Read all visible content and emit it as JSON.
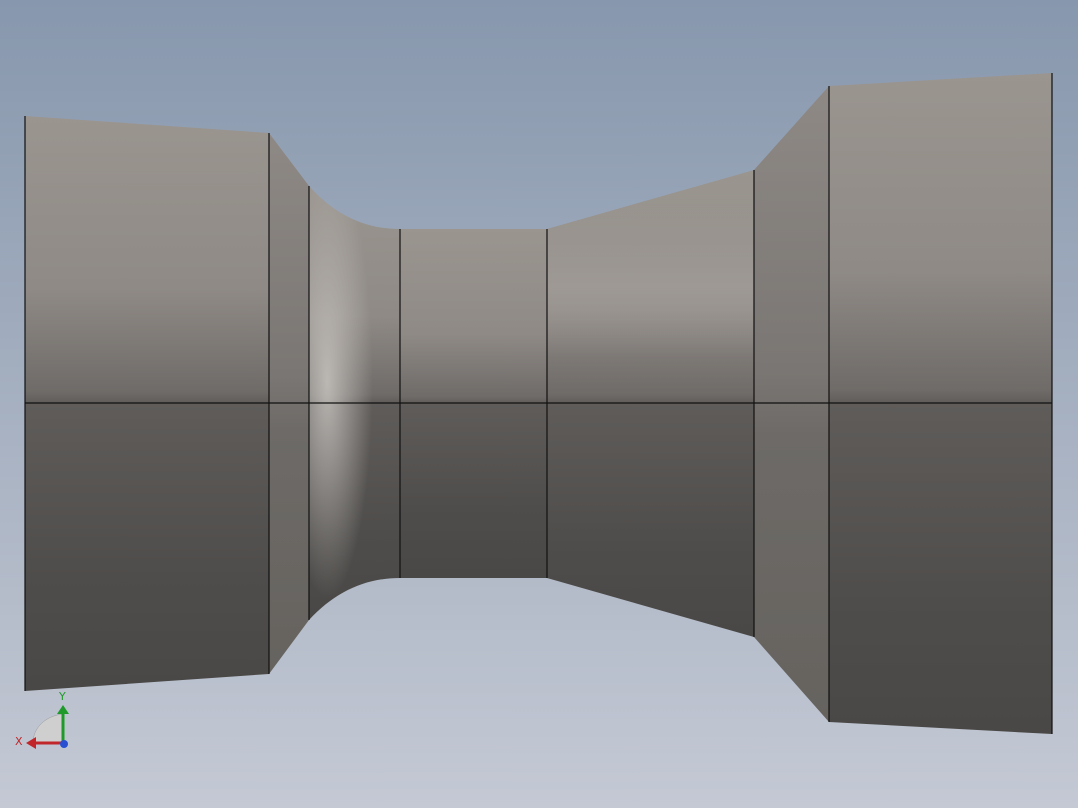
{
  "viewport": {
    "background_top": "#8797ad",
    "background_bottom": "#c4c9d4",
    "model": {
      "name": "nozzle-body",
      "edge_color": "#111111",
      "surface_light": "#a29d98",
      "surface_mid": "#7a7673",
      "surface_dark": "#4a4846"
    }
  },
  "triad": {
    "x_label": "X",
    "y_label": "Y",
    "x_color": "#c0262a",
    "y_color": "#1f9a2a",
    "z_color": "#2a4fd0"
  }
}
